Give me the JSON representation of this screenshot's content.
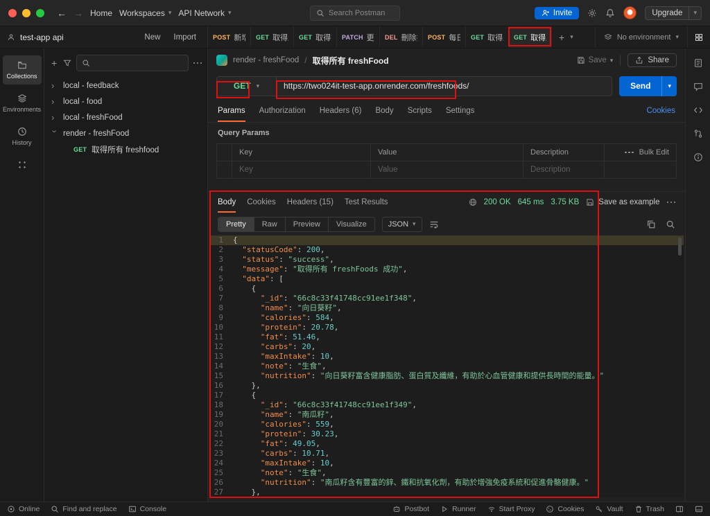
{
  "titlebar": {
    "home": "Home",
    "workspaces": "Workspaces",
    "api_network": "API Network",
    "search_placeholder": "Search Postman",
    "invite_label": "Invite",
    "upgrade_label": "Upgrade"
  },
  "workspace": {
    "name": "test-app api",
    "new_label": "New",
    "import_label": "Import"
  },
  "request_tabs": [
    {
      "method": "POST",
      "label": "新增"
    },
    {
      "method": "GET",
      "label": "取得所"
    },
    {
      "method": "GET",
      "label": "取得指"
    },
    {
      "method": "PATCH",
      "label": "更新"
    },
    {
      "method": "DEL",
      "label": "刪除指"
    },
    {
      "method": "POST",
      "label": "每日目"
    },
    {
      "method": "GET",
      "label": "取得所"
    },
    {
      "method": "GET",
      "label": "取得所",
      "active": true
    }
  ],
  "environment": {
    "selected": "No environment"
  },
  "sidebar": {
    "nav": [
      {
        "label": "Collections",
        "active": true
      },
      {
        "label": "Environments"
      },
      {
        "label": "History"
      }
    ],
    "tree": [
      {
        "label": "local - feedback",
        "expanded": false
      },
      {
        "label": "local - food",
        "expanded": false
      },
      {
        "label": "local - freshFood",
        "expanded": false
      },
      {
        "label": "render - freshFood",
        "expanded": true,
        "children": [
          {
            "method": "GET",
            "label": "取得所有 freshfood"
          }
        ]
      }
    ]
  },
  "request": {
    "breadcrumb_collection": "render - freshFood",
    "title": "取得所有 freshFood",
    "save_label": "Save",
    "share_label": "Share",
    "method": "GET",
    "url": "https://two024it-test-app.onrender.com/freshfoods/",
    "send_label": "Send",
    "tabs": [
      "Params",
      "Authorization",
      "Headers (6)",
      "Body",
      "Scripts",
      "Settings"
    ],
    "active_tab": "Params",
    "cookies_link": "Cookies",
    "query_params_title": "Query Params",
    "columns": [
      "Key",
      "Value",
      "Description"
    ],
    "bulk_edit": "Bulk Edit",
    "placeholders": {
      "key": "Key",
      "value": "Value",
      "description": "Description"
    }
  },
  "response": {
    "tabs": [
      "Body",
      "Cookies",
      "Headers (15)",
      "Test Results"
    ],
    "active_tab": "Body",
    "status": "200 OK",
    "time": "645 ms",
    "size": "3.75 KB",
    "save_as_example": "Save as example",
    "view_tabs": [
      "Pretty",
      "Raw",
      "Preview",
      "Visualize"
    ],
    "active_view": "Pretty",
    "format": "JSON",
    "highlight_line": 1,
    "code_lines": [
      "{",
      "  \"statusCode\": 200,",
      "  \"status\": \"success\",",
      "  \"message\": \"取得所有 freshFoods 成功\",",
      "  \"data\": [",
      "    {",
      "      \"_id\": \"66c8c33f41748cc91ee1f348\",",
      "      \"name\": \"向日葵籽\",",
      "      \"calories\": 584,",
      "      \"protein\": 20.78,",
      "      \"fat\": 51.46,",
      "      \"carbs\": 20,",
      "      \"maxIntake\": 10,",
      "      \"note\": \"生食\",",
      "      \"nutrition\": \"向日葵籽富含健康脂肪、蛋白質及纖維，有助於心血管健康和提供長時間的能量。\"",
      "    },",
      "    {",
      "      \"_id\": \"66c8c33f41748cc91ee1f349\",",
      "      \"name\": \"南瓜籽\",",
      "      \"calories\": 559,",
      "      \"protein\": 30.23,",
      "      \"fat\": 49.05,",
      "      \"carbs\": 10.71,",
      "      \"maxIntake\": 10,",
      "      \"note\": \"生食\",",
      "      \"nutrition\": \"南瓜籽含有豐富的鋅、鐵和抗氧化劑，有助於增強免疫系統和促進骨骼健康。\"",
      "    },"
    ]
  },
  "statusbar": {
    "online": "Online",
    "find": "Find and replace",
    "console": "Console",
    "postbot": "Postbot",
    "runner": "Runner",
    "proxy": "Start Proxy",
    "cookies": "Cookies",
    "vault": "Vault",
    "trash": "Trash"
  },
  "colors": {
    "accent_blue": "#0265d2",
    "get_green": "#6bdd9a",
    "post_orange": "#ffb25c",
    "patch_purple": "#c0a8e1",
    "delete_red": "#f79a8e",
    "annotation_red": "#e01010",
    "active_underline": "#ff6c37"
  }
}
